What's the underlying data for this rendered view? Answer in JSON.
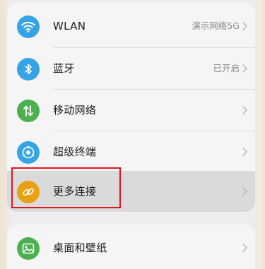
{
  "settings": {
    "items": [
      {
        "label": "WLAN",
        "value": "演示网络5G",
        "icon": "wifi-icon",
        "icon_color": "#35a3e6"
      },
      {
        "label": "蓝牙",
        "value": "已开启",
        "icon": "bluetooth-icon",
        "icon_color": "#35a3e6"
      },
      {
        "label": "移动网络",
        "value": "",
        "icon": "mobile-data-icon",
        "icon_color": "#4caf50"
      },
      {
        "label": "超级终端",
        "value": "",
        "icon": "super-device-icon",
        "icon_color": "#35a3e6"
      },
      {
        "label": "更多连接",
        "value": "",
        "icon": "link-icon",
        "icon_color": "#e8a113"
      }
    ],
    "section2": [
      {
        "label": "桌面和壁纸",
        "value": "",
        "icon": "wallpaper-icon",
        "icon_color": "#4caf50"
      }
    ]
  },
  "highlight": {
    "target": "更多连接",
    "color": "#e0151d"
  }
}
